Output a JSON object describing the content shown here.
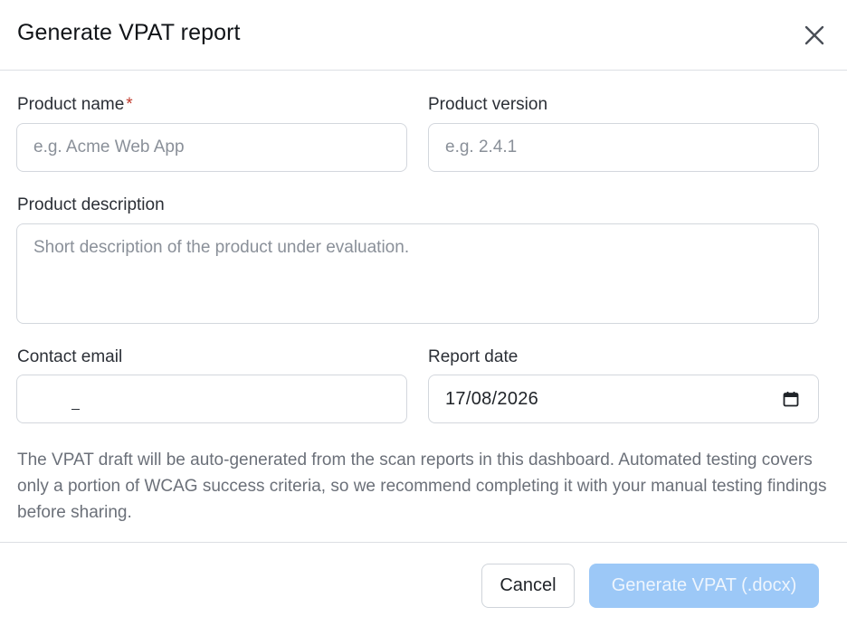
{
  "dialog": {
    "title": "Generate VPAT report",
    "close_icon": "close-icon"
  },
  "form": {
    "product_name": {
      "label": "Product name",
      "required_mark": "*",
      "placeholder": "e.g. Acme Web App",
      "value": ""
    },
    "product_version": {
      "label": "Product version",
      "placeholder": "e.g. 2.4.1",
      "value": ""
    },
    "product_description": {
      "label": "Product description",
      "placeholder": "Short description of the product under evaluation.",
      "value": ""
    },
    "contact_email": {
      "label": "Contact email",
      "value": ""
    },
    "report_date": {
      "label": "Report date",
      "value": "17/08/2026",
      "icon": "calendar-icon"
    }
  },
  "note": "The VPAT draft will be auto-generated from the scan reports in this dashboard. Automated testing covers only a portion of WCAG success criteria, so we recommend completing it with your manual testing findings before sharing.",
  "footer": {
    "cancel_label": "Cancel",
    "generate_label": "Generate VPAT (.docx)"
  },
  "colors": {
    "primary_disabled": "#9cc8f7",
    "required": "#c0392b",
    "border": "#d3d7dd"
  }
}
